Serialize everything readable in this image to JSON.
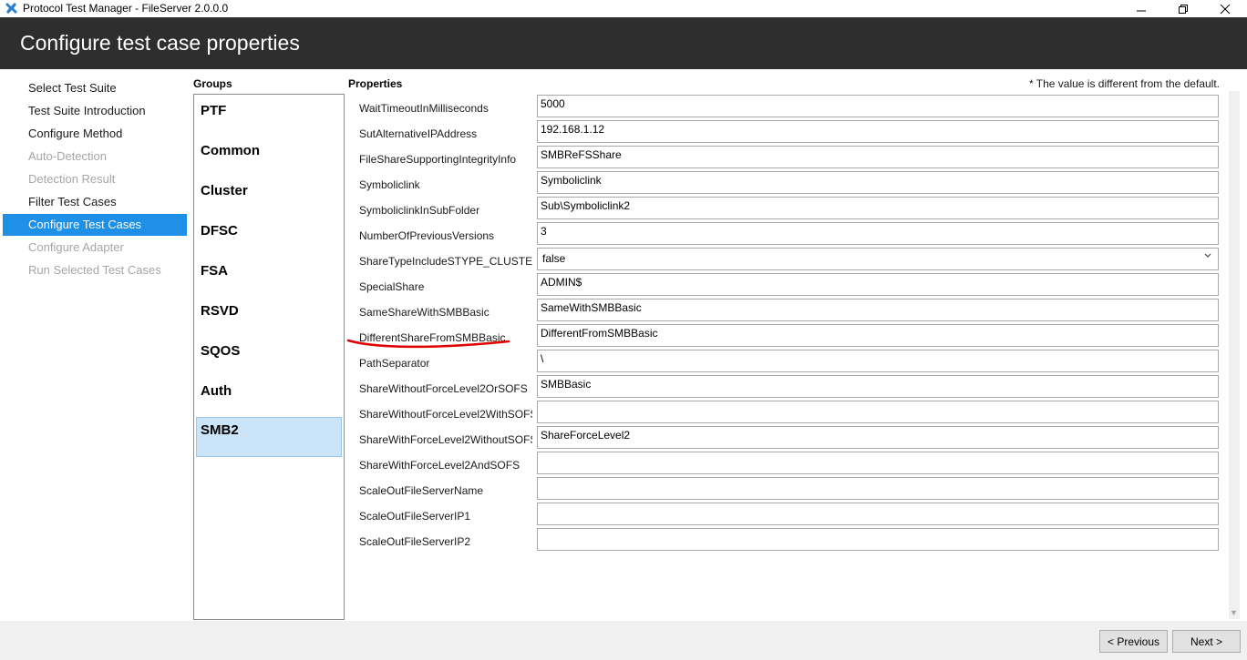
{
  "window": {
    "title": "Protocol Test Manager - FileServer 2.0.0.0"
  },
  "header": {
    "title": "Configure test case properties"
  },
  "nav": {
    "items": [
      {
        "label": "Select Test Suite",
        "state": "enabled"
      },
      {
        "label": "Test Suite Introduction",
        "state": "enabled"
      },
      {
        "label": "Configure Method",
        "state": "enabled"
      },
      {
        "label": "Auto-Detection",
        "state": "disabled"
      },
      {
        "label": "Detection Result",
        "state": "disabled"
      },
      {
        "label": "Filter Test Cases",
        "state": "enabled"
      },
      {
        "label": "Configure Test Cases",
        "state": "active"
      },
      {
        "label": "Configure Adapter",
        "state": "disabled"
      },
      {
        "label": "Run Selected Test Cases",
        "state": "disabled"
      }
    ]
  },
  "groups": {
    "label": "Groups",
    "items": [
      "PTF",
      "Common",
      "Cluster",
      "DFSC",
      "FSA",
      "RSVD",
      "SQOS",
      "Auth",
      "SMB2"
    ],
    "selected": "SMB2"
  },
  "properties": {
    "label": "Properties",
    "note": "* The value is different from the default.",
    "rows": [
      {
        "name": "WaitTimeoutInMilliseconds",
        "value": "5000",
        "type": "text"
      },
      {
        "name": "SutAlternativeIPAddress",
        "value": "192.168.1.12",
        "type": "text"
      },
      {
        "name": "FileShareSupportingIntegrityInfo",
        "value": "SMBReFSShare",
        "type": "text"
      },
      {
        "name": "Symboliclink",
        "value": "Symboliclink",
        "type": "text"
      },
      {
        "name": "SymboliclinkInSubFolder",
        "value": "Sub\\Symboliclink2",
        "type": "text"
      },
      {
        "name": "NumberOfPreviousVersions",
        "value": "3",
        "type": "text"
      },
      {
        "name": "ShareTypeIncludeSTYPE_CLUSTER_SOFS",
        "value": "false",
        "type": "select"
      },
      {
        "name": "SpecialShare",
        "value": "ADMIN$",
        "type": "text"
      },
      {
        "name": "SameShareWithSMBBasic",
        "value": "SameWithSMBBasic",
        "type": "text"
      },
      {
        "name": "DifferentShareFromSMBBasic",
        "value": "DifferentFromSMBBasic",
        "type": "text"
      },
      {
        "name": "PathSeparator",
        "value": "\\",
        "type": "text"
      },
      {
        "name": "ShareWithoutForceLevel2OrSOFS",
        "value": "SMBBasic",
        "type": "text"
      },
      {
        "name": "ShareWithoutForceLevel2WithSOFS",
        "value": "",
        "type": "text"
      },
      {
        "name": "ShareWithForceLevel2WithoutSOFS",
        "value": "ShareForceLevel2",
        "type": "text"
      },
      {
        "name": "ShareWithForceLevel2AndSOFS",
        "value": "",
        "type": "text"
      },
      {
        "name": "ScaleOutFileServerName",
        "value": "",
        "type": "text"
      },
      {
        "name": "ScaleOutFileServerIP1",
        "value": "",
        "type": "text"
      },
      {
        "name": "ScaleOutFileServerIP2",
        "value": "",
        "type": "text"
      }
    ]
  },
  "buttons": {
    "previous": "< Previous",
    "next": "Next >"
  },
  "colors": {
    "header_bg": "#2e2e2e",
    "active_nav": "#1e90e8",
    "selected_group": "#cce4f7",
    "annotation": "#e00000"
  },
  "icons": {
    "app": "wrench-icon",
    "minimize": "minimize-icon",
    "maximize": "restore-icon",
    "close": "close-icon",
    "dropdown": "chevron-down-icon"
  }
}
